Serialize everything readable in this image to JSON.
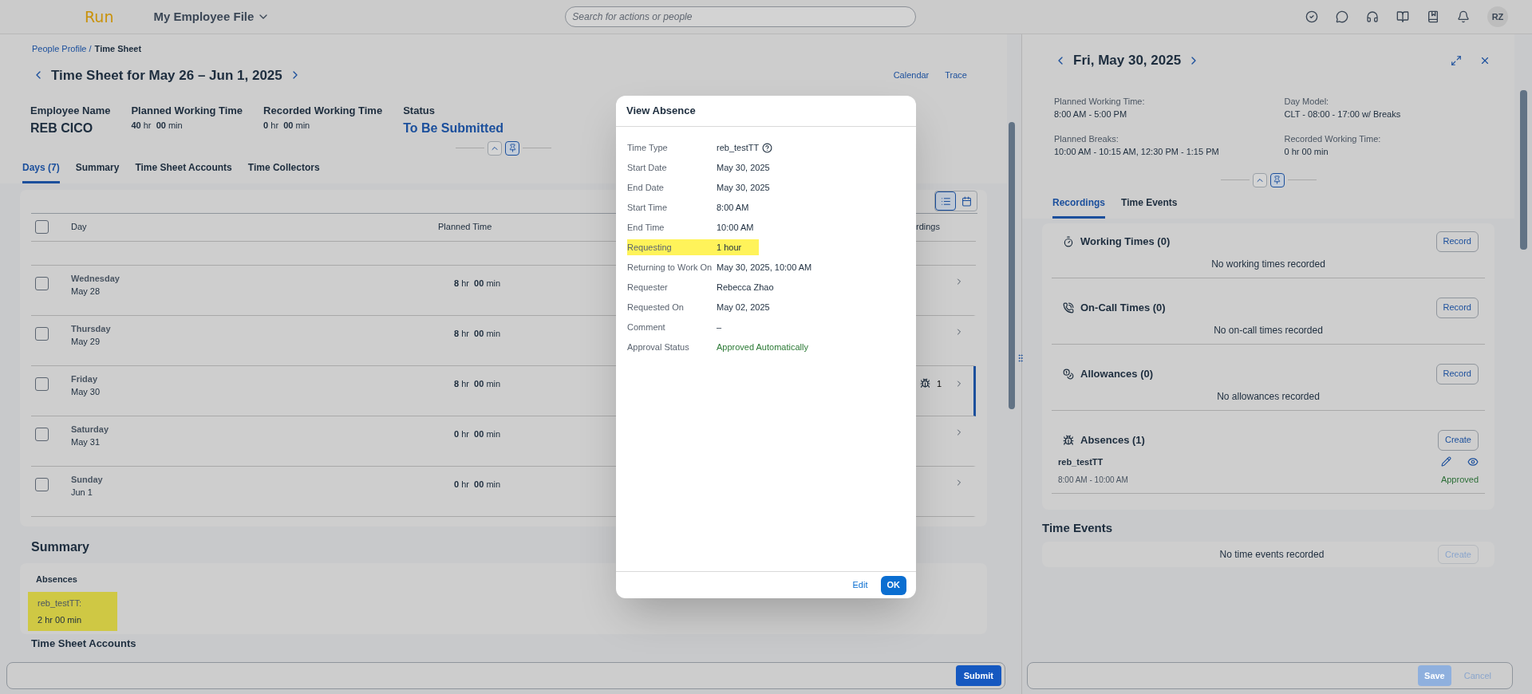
{
  "top_bar": {
    "logo": "Run",
    "app_menu": "My Employee File",
    "search": {
      "placeholder": "Search for actions or people"
    },
    "actions": [
      {
        "kind": "tasks"
      },
      {
        "kind": "chat"
      },
      {
        "kind": "support"
      },
      {
        "kind": "guide"
      },
      {
        "kind": "whats_new"
      },
      {
        "kind": "notifications"
      }
    ],
    "avatar": "RZ"
  },
  "time_sheet": {
    "breadcrumb": [
      {
        "label": "People Profile /",
        "link": true
      },
      {
        "label": "Time Sheet",
        "link": false
      }
    ],
    "title": "Time Sheet for May 26 – Jun 1, 2025",
    "links": [
      "Calendar",
      "Trace"
    ],
    "facts": [
      {
        "label": "Employee Name",
        "value": "REB CICO",
        "kind": "name"
      },
      {
        "label": "Planned Working Time",
        "value": "**40** hr  **00** min",
        "kind": "duration"
      },
      {
        "label": "Recorded Working Time",
        "value": "**0** hr  **00** min",
        "kind": "duration"
      },
      {
        "label": "Status",
        "value": "To Be Submitted",
        "kind": "status"
      }
    ],
    "pinned": true,
    "tabs": [
      {
        "label": "Days (7)",
        "selected": true
      },
      {
        "label": "Summary",
        "selected": false
      },
      {
        "label": "Time Sheet Accounts",
        "selected": false
      },
      {
        "label": "Time Collectors",
        "selected": false
      }
    ],
    "view_toggle": [
      {
        "kind": "list",
        "selected": true
      },
      {
        "kind": "calendar",
        "selected": false
      }
    ],
    "table": {
      "all_checked": false,
      "columns": [
        "Day",
        "Planned Time",
        "rdings"
      ],
      "rows": [
        {
          "day": "Wednesday",
          "date": "May 28",
          "planned": "**8** hr  **00** min",
          "checked": false,
          "selected": false
        },
        {
          "day": "Thursday",
          "date": "May 29",
          "planned": "**8** hr  **00** min",
          "checked": false,
          "selected": false
        },
        {
          "day": "Friday",
          "date": "May 30",
          "planned": "**8** hr  **00** min",
          "checked": false,
          "selected": true,
          "absences": "1"
        },
        {
          "day": "Saturday",
          "date": "May 31",
          "planned": "**0** hr  **00** min",
          "checked": false,
          "selected": false
        },
        {
          "day": "Sunday",
          "date": "Jun 1",
          "planned": "**0** hr  **00** min",
          "checked": false,
          "selected": false
        }
      ]
    },
    "summary": {
      "title": "Summary",
      "card_title": "Absences",
      "items": [
        {
          "label": "reb_testTT:",
          "value": "2 hr 00 min",
          "highlighted": true
        }
      ]
    },
    "next_section": "Time Sheet Accounts",
    "footer": {
      "submit": "Submit"
    }
  },
  "day_detail": {
    "title": "Fri, May 30, 2025",
    "info": [
      {
        "label": "Planned Working Time:",
        "value": "8:00 AM - 5:00 PM"
      },
      {
        "label": "Day Model:",
        "value": "CLT - 08:00 - 17:00 w/ Breaks"
      },
      {
        "label": "Planned Breaks:",
        "value": "10:00 AM - 10:15 AM, 12:30 PM - 1:15 PM"
      },
      {
        "label": "Recorded Working Time:",
        "value": "0 hr 00 min"
      }
    ],
    "pinned": true,
    "tabs": [
      {
        "label": "Recordings",
        "selected": true
      },
      {
        "label": "Time Events",
        "selected": false
      }
    ],
    "sections": [
      {
        "kind": "working_times",
        "title": "Working Times (0)",
        "action": "Record",
        "empty": "No working times recorded"
      },
      {
        "kind": "on_call",
        "title": "On-Call Times (0)",
        "action": "Record",
        "empty": "No on-call times recorded"
      },
      {
        "kind": "allowances",
        "title": "Allowances (0)",
        "action": "Record",
        "empty": "No allowances recorded"
      },
      {
        "kind": "absences",
        "title": "Absences (1)",
        "action": "Create",
        "entries": [
          {
            "name": "reb_testTT",
            "time": "8:00 AM - 10:00 AM",
            "status": "Approved"
          }
        ]
      }
    ],
    "time_events": {
      "title": "Time Events",
      "action": "Create",
      "action_disabled": true,
      "empty": "No time events recorded"
    },
    "footer": {
      "save": "Save",
      "cancel": "Cancel",
      "disabled": true
    }
  },
  "dialog": {
    "title": "View Absence",
    "fields": [
      {
        "label": "Time Type",
        "value": "reb_testTT",
        "help": true,
        "highlighted": false
      },
      {
        "label": "Start Date",
        "value": "May 30, 2025",
        "highlighted": false
      },
      {
        "label": "End Date",
        "value": "May 30, 2025",
        "highlighted": false
      },
      {
        "label": "Start Time",
        "value": "8:00 AM",
        "highlighted": false
      },
      {
        "label": "End Time",
        "value": "10:00 AM",
        "highlighted": false
      },
      {
        "label": "Requesting",
        "value": "1 hour",
        "highlighted": true
      },
      {
        "label": "Returning to Work On",
        "value": "May 30, 2025, 10:00 AM",
        "highlighted": false
      },
      {
        "label": "Requester",
        "value": "Rebecca Zhao",
        "highlighted": false
      },
      {
        "label": "Requested On",
        "value": "May 02, 2025",
        "highlighted": false
      },
      {
        "label": "Comment",
        "value": "–",
        "highlighted": false
      },
      {
        "label": "Approval Status",
        "value": "Approved Automatically",
        "kind": "status",
        "highlighted": false
      }
    ],
    "buttons": [
      {
        "label": "Edit",
        "kind": "secondary"
      },
      {
        "label": "OK",
        "kind": "primary"
      }
    ]
  }
}
